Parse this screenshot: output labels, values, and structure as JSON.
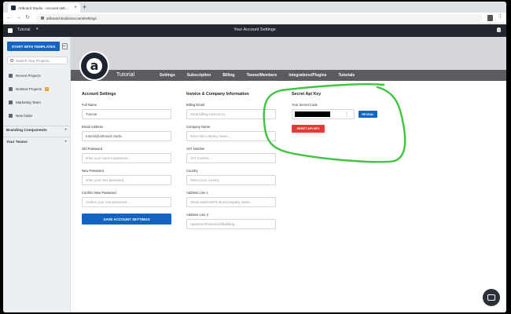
{
  "browser": {
    "tab_title": "Artboard Studio - Account sett...",
    "tab_close": "×",
    "new_tab": "+",
    "url": "artboard.studio/account/settings",
    "back": "←",
    "forward": "→",
    "reload": "↻",
    "menu": "⋮"
  },
  "appbar": {
    "project": "Tutorial",
    "caret": "▾",
    "title": "Your Account Settings"
  },
  "sidebar": {
    "start_button": "START WITH TEMPLATES",
    "collapse": "⇤",
    "search_placeholder": "Search Your Projects...",
    "items": [
      {
        "label": "Recent Projects"
      },
      {
        "label": "Deleted Projects",
        "badge": "3"
      },
      {
        "label": "Marketing Team"
      },
      {
        "label": "New folder"
      }
    ],
    "sections": [
      {
        "label": "Branding Components",
        "plus": "+"
      },
      {
        "label": "Your Teams",
        "plus": "+"
      }
    ]
  },
  "header": {
    "avatar_letter": "a",
    "project_name": "Tutorial",
    "tabs": [
      "Settings",
      "Subscription",
      "Billing",
      "Teams/Members",
      "Integrations/Plugins",
      "Tutorials"
    ]
  },
  "account": {
    "title": "Account Settings",
    "full_name_label": "Full Name",
    "full_name_value": "Tutorial",
    "email_label": "Email Address",
    "email_value": "tutorial@artboard.studio",
    "old_password_label": "Old Password",
    "old_password_placeholder": "enter your current password...",
    "new_password_label": "New Password",
    "new_password_placeholder": "enter your new password...",
    "confirm_password_label": "Confirm New Password",
    "confirm_password_placeholder": "confirm your new password...",
    "save_button": "SAVE ACCOUNT SETTINGS"
  },
  "invoice": {
    "title": "Invoice & Company Information",
    "billing_email_label": "Billing Email",
    "billing_email_placeholder": "Send billing invoices to...",
    "company_name_label": "Company Name",
    "company_name_placeholder": "Enter full company name...",
    "vat_label": "VAT Number",
    "vat_placeholder": "VAT number...",
    "country_label": "Country",
    "country_placeholder": "Select your country",
    "address1_label": "Address Line 1",
    "address1_placeholder": "Street address/PO Box/Company name...",
    "address2_label": "Address Line 2",
    "address2_placeholder": "Apartment/Suite/Unit/Building..."
  },
  "secret": {
    "title": "Secret Api Key",
    "code_label": "Your Secret Code",
    "dots": "⋮",
    "reveal_button": "REVEAL",
    "reset_button": "RESET API KEY"
  },
  "colors": {
    "primary": "#1565c0",
    "danger": "#e53935",
    "annotation": "#3ec43e",
    "appbar": "#23272f",
    "subnav": "#5a5c60"
  }
}
